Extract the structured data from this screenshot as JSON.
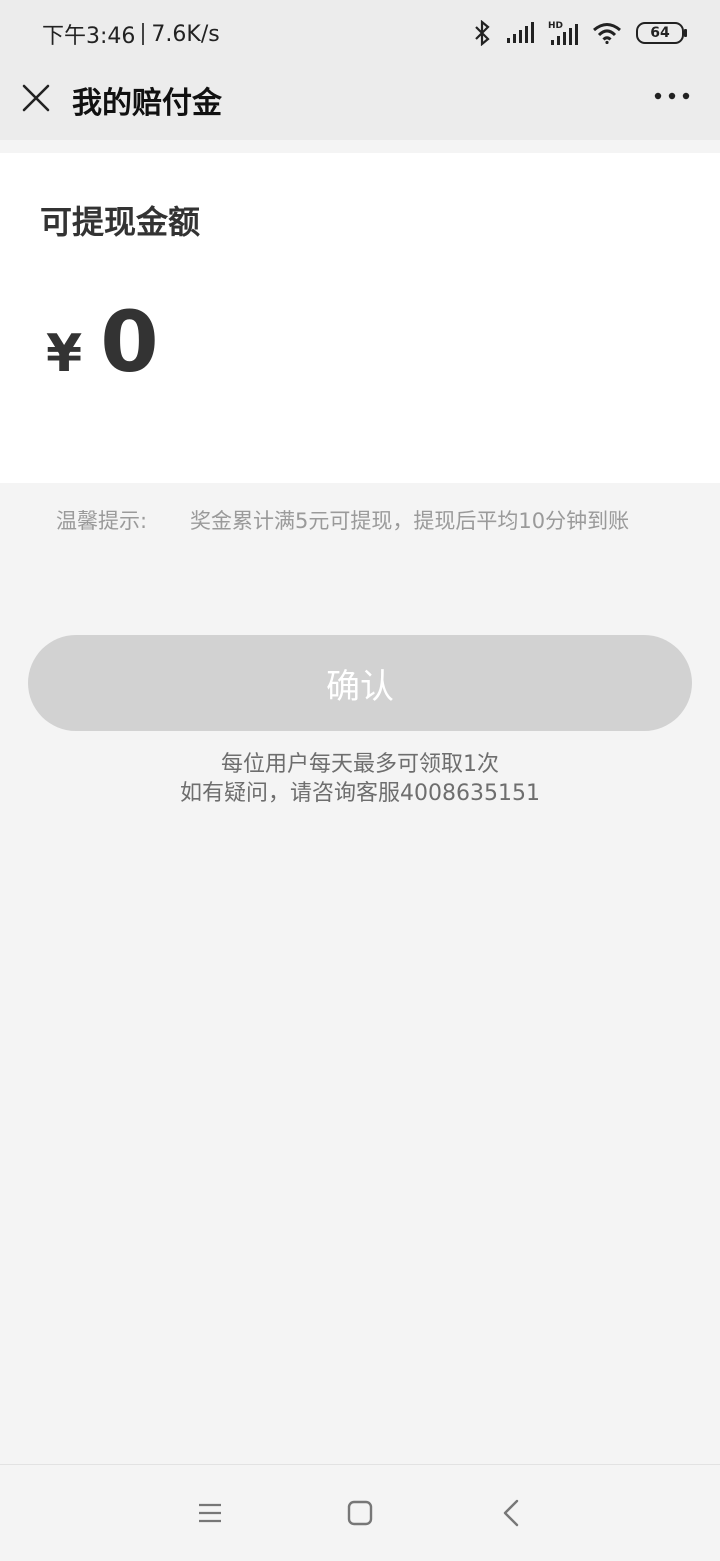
{
  "status_bar": {
    "time": "下午3:46",
    "network_speed": "7.6K/s",
    "battery": "64",
    "icons": [
      "bluetooth-icon",
      "signal-icon",
      "hd-signal-icon",
      "wifi-icon",
      "battery-icon"
    ]
  },
  "nav": {
    "title": "我的赔付金",
    "close_icon": "close-icon",
    "more_icon": "more-icon"
  },
  "card": {
    "label": "可提现金额",
    "currency": "¥",
    "amount": "0"
  },
  "tip": {
    "label": "温馨提示:",
    "text": "奖金累计满5元可提现，提现后平均10分钟到账"
  },
  "confirm_button": {
    "label": "确认"
  },
  "notes": {
    "line1": "每位用户每天最多可领取1次",
    "line2": "如有疑问，请咨询客服4008635151"
  },
  "system_nav": {
    "icons": [
      "menu-icon",
      "home-icon",
      "back-icon"
    ]
  },
  "colors": {
    "header_bg": "#ececec",
    "page_bg": "#f4f4f4",
    "button_disabled": "#d2d2d2",
    "text_primary": "#333333",
    "text_muted": "#9a9a9a"
  }
}
